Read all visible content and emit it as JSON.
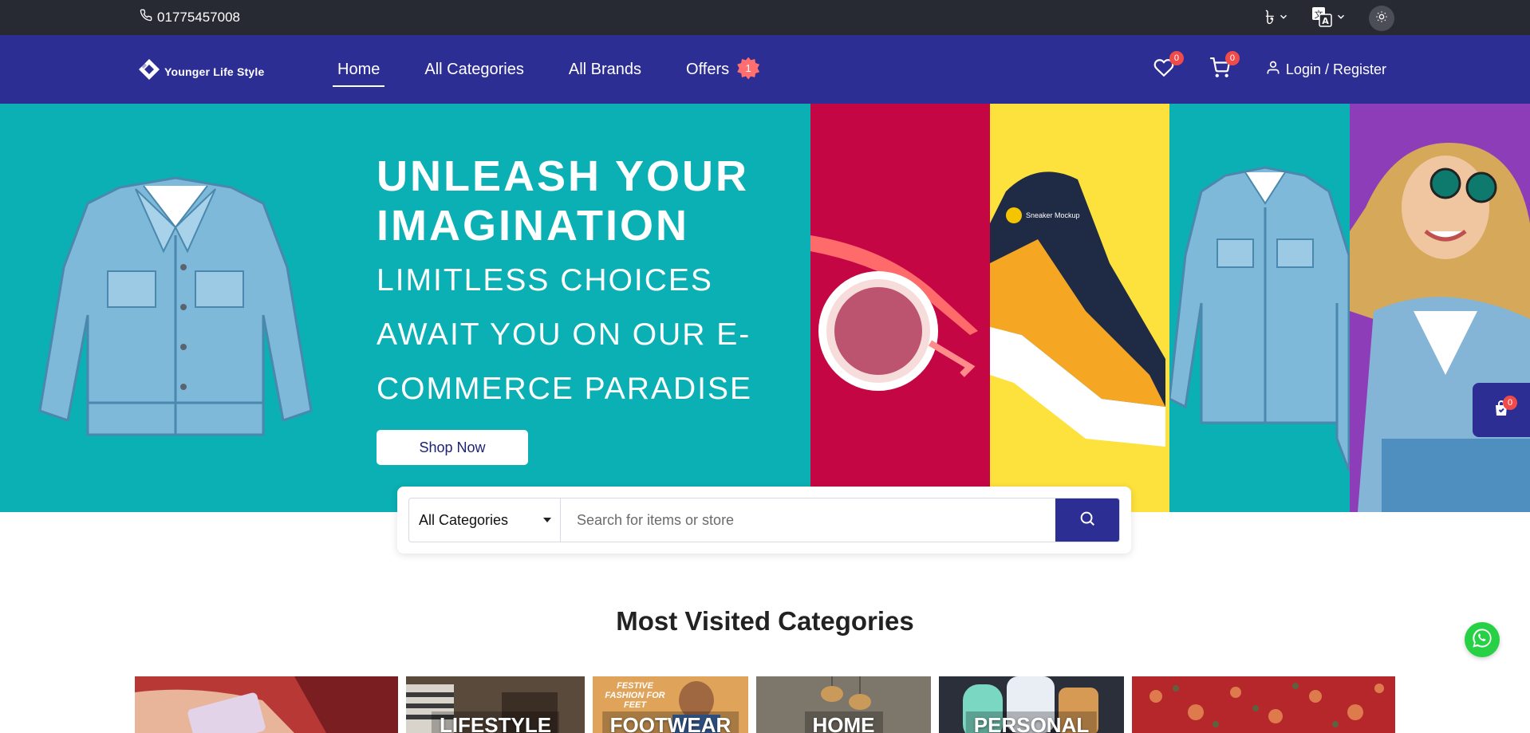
{
  "topbar": {
    "phone": "01775457008",
    "currency_icon": "taka-icon",
    "language_icon": "translate-icon",
    "theme_icon": "sun-icon"
  },
  "nav": {
    "logo_text": "Younger Life Style",
    "links": [
      {
        "label": "Home",
        "active": true
      },
      {
        "label": "All Categories"
      },
      {
        "label": "All Brands"
      },
      {
        "label": "Offers",
        "badge": "1"
      }
    ],
    "wishlist_count": "0",
    "cart_count": "0",
    "login_label": "Login / Register"
  },
  "hero": {
    "title": "UNLEASH YOUR IMAGINATION",
    "subtitle": "LIMITLESS CHOICES AWAIT YOU ON OUR E-COMMERCE PARADISE",
    "cta": "Shop Now",
    "sneaker_text": "Sneaker Mockup",
    "colors": {
      "teal": "#0ab0b4",
      "red": "#c40644",
      "yellow": "#fde13d",
      "purple": "#8d3db8"
    }
  },
  "search": {
    "category": "All Categories",
    "placeholder": "Search for items or store"
  },
  "section": {
    "title": "Most Visited Categories",
    "categories": [
      {
        "label": ""
      },
      {
        "label": "LIFESTYLE"
      },
      {
        "label": "FOOTWEAR",
        "banner": "FESTIVE FASHION FOR FEET"
      },
      {
        "label": "HOME"
      },
      {
        "label": "PERSONAL"
      },
      {
        "label": ""
      }
    ]
  },
  "floating": {
    "cart_count": "0"
  },
  "theme": {
    "accent": "#2d2e93",
    "topbar": "#272a33",
    "badge": "#f04b4b"
  }
}
